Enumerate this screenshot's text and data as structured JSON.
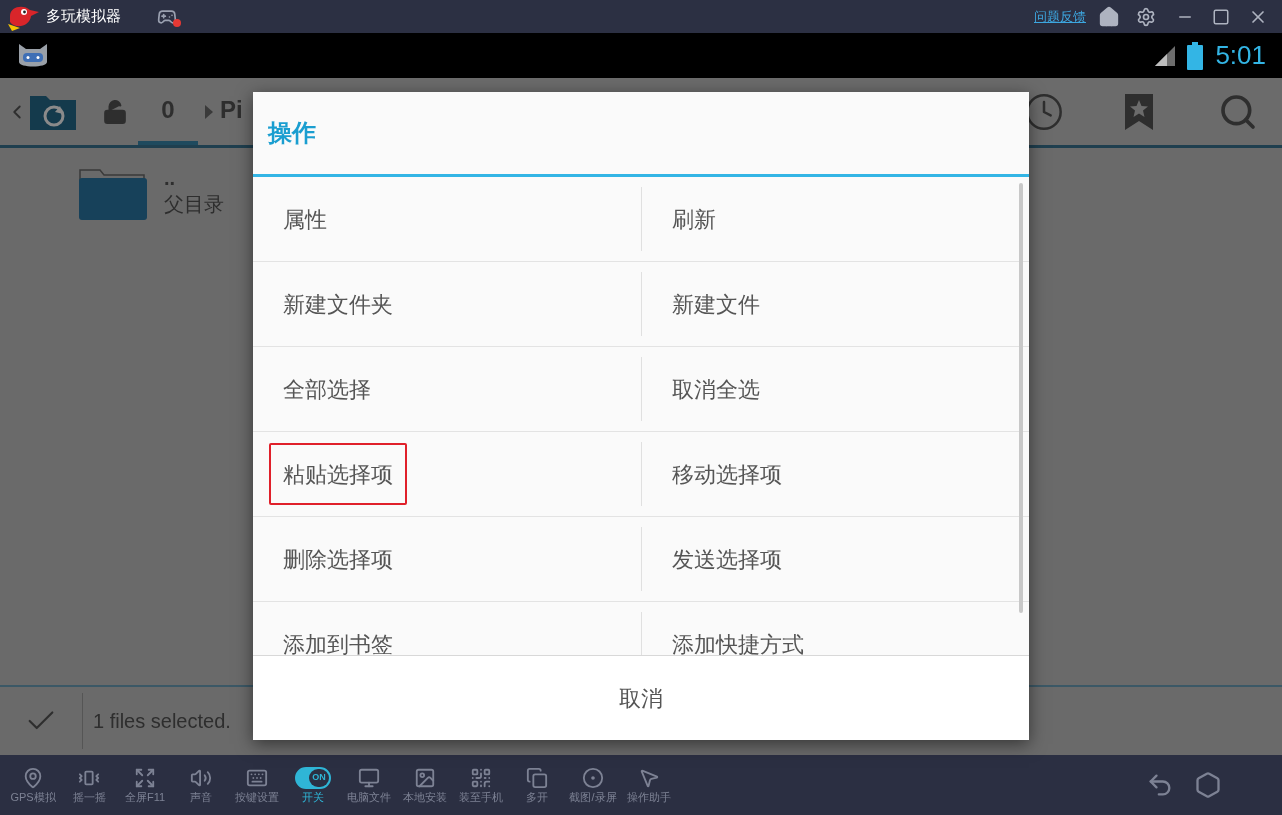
{
  "emulator": {
    "title": "多玩模拟器",
    "feedback_link": "问题反馈"
  },
  "status_bar": {
    "time": "5:01"
  },
  "file_browser": {
    "path": [
      {
        "label": "0",
        "selected": true
      },
      {
        "label": "Pi",
        "selected": false
      }
    ],
    "items": [
      {
        "name": "..",
        "description": "父目录"
      }
    ],
    "selection_status": "1 files selected."
  },
  "dialog": {
    "title": "操作",
    "options": [
      {
        "label": "属性",
        "highlighted": false
      },
      {
        "label": "刷新",
        "highlighted": false
      },
      {
        "label": "新建文件夹",
        "highlighted": false
      },
      {
        "label": "新建文件",
        "highlighted": false
      },
      {
        "label": "全部选择",
        "highlighted": false
      },
      {
        "label": "取消全选",
        "highlighted": false
      },
      {
        "label": "粘贴选择项",
        "highlighted": true
      },
      {
        "label": "移动选择项",
        "highlighted": false
      },
      {
        "label": "删除选择项",
        "highlighted": false
      },
      {
        "label": "发送选择项",
        "highlighted": false
      },
      {
        "label": "添加到书签",
        "highlighted": false
      },
      {
        "label": "添加快捷方式",
        "highlighted": false
      }
    ],
    "cancel": "取消"
  },
  "toolbar": [
    {
      "label": "GPS模拟",
      "kind": "button"
    },
    {
      "label": "摇一摇",
      "kind": "button"
    },
    {
      "label": "全屏F11",
      "kind": "button"
    },
    {
      "label": "声音",
      "kind": "button"
    },
    {
      "label": "按键设置",
      "kind": "button"
    },
    {
      "label": "开关",
      "kind": "toggle",
      "on": true,
      "toggle_text": "ON"
    },
    {
      "label": "电脑文件",
      "kind": "button"
    },
    {
      "label": "本地安装",
      "kind": "button"
    },
    {
      "label": "装至手机",
      "kind": "button"
    },
    {
      "label": "多开",
      "kind": "button"
    },
    {
      "label": "截图/录屏",
      "kind": "button"
    },
    {
      "label": "操作助手",
      "kind": "button"
    }
  ]
}
